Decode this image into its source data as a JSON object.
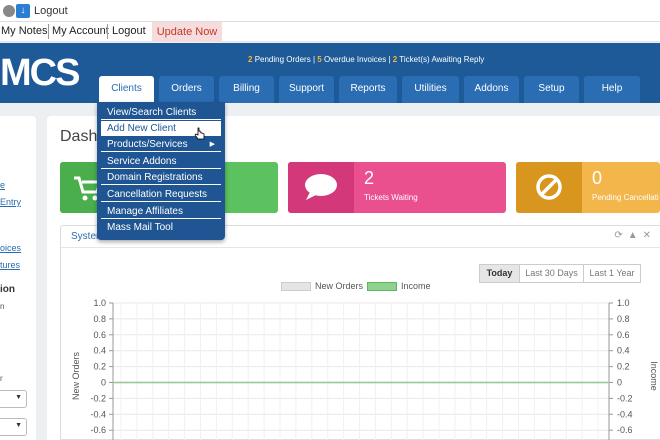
{
  "topbar": {
    "logout": "Logout"
  },
  "userbar": {
    "my_notes": "My Notes",
    "my_account": "My Account",
    "logout": "Logout",
    "update_now": "Update Now"
  },
  "header": {
    "logo_text": "MCS",
    "alerts": {
      "pending_orders_count": "2",
      "pending_orders_label": "Pending Orders",
      "overdue_count": "5",
      "overdue_label": "Overdue Invoices",
      "tickets_count": "2",
      "tickets_label": "Ticket(s) Awaiting Reply",
      "separator": "|"
    },
    "nav": [
      "Clients",
      "Orders",
      "Billing",
      "Support",
      "Reports",
      "Utilities",
      "Addons",
      "Setup",
      "Help"
    ]
  },
  "clients_menu": [
    "View/Search Clients",
    "Add New Client",
    "Products/Services",
    "Service Addons",
    "Domain Registrations",
    "Cancellation Requests",
    "Manage Affiliates",
    "Mass Mail Tool"
  ],
  "sidebar": {
    "links": [
      "e",
      "Entry",
      "oices",
      "tures"
    ],
    "heading": "ion",
    "small_text": [
      "n",
      "r"
    ]
  },
  "main": {
    "page_title": "Dashb",
    "cards": {
      "tickets": {
        "count": "2",
        "label": "Tickets Waiting"
      },
      "cancellations": {
        "count": "0",
        "label": "Pending Cancellati"
      }
    },
    "system_panel": {
      "title": "Syster",
      "buttons": [
        "Today",
        "Last 30 Days",
        "Last 1 Year"
      ],
      "legend": [
        "New Orders",
        "Income"
      ],
      "left_axis_label": "New Orders",
      "right_axis_label": "Income"
    }
  },
  "colors": {
    "header_blue": "#1d5a97",
    "green_card": "#5cc25f",
    "pink_card": "#ea4f8e",
    "orange_card": "#f2b64a",
    "alert_orange": "#f3b63d",
    "update_red": "#c0392b",
    "income_green": "#8fd18f",
    "orders_grey": "#dddddd"
  },
  "chart_data": {
    "type": "line",
    "x": [],
    "series": [
      {
        "name": "New Orders",
        "values": [
          0,
          0,
          0,
          0,
          0,
          0,
          0,
          0,
          0,
          0,
          0,
          0,
          0,
          0,
          0,
          0,
          0,
          0,
          0,
          0,
          0,
          0,
          0,
          0
        ]
      },
      {
        "name": "Income",
        "values": [
          0,
          0,
          0,
          0,
          0,
          0,
          0,
          0,
          0,
          0,
          0,
          0,
          0,
          0,
          0,
          0,
          0,
          0,
          0,
          0,
          0,
          0,
          0,
          0
        ]
      }
    ],
    "ylim": [
      -1.0,
      1.0
    ],
    "y_ticks": [
      "1.0",
      "0.8",
      "0.6",
      "0.4",
      "0.2",
      "0",
      "-0.2",
      "-0.4",
      "-0.6"
    ],
    "ylabel": "New Orders",
    "y2label": "Income",
    "grid": true,
    "legend": "top-center"
  }
}
